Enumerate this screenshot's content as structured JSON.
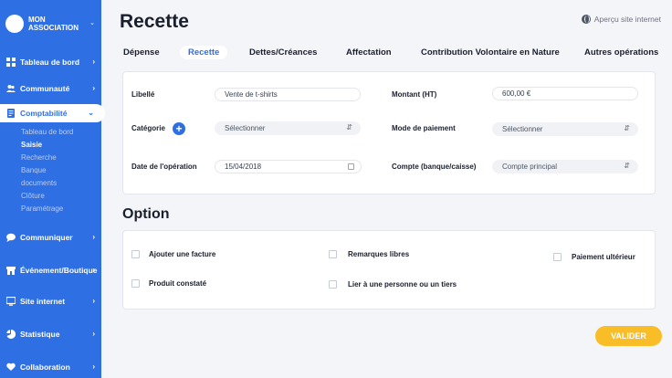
{
  "sidebar": {
    "brand": "MON\nASSOCIATION",
    "items": [
      {
        "label": "Tableau de bord",
        "icon": "dashboard-icon"
      },
      {
        "label": "Communauté",
        "icon": "users-icon"
      },
      {
        "label": "Comptabilité",
        "icon": "ledger-icon"
      },
      {
        "label": "Communiquer",
        "icon": "chat-icon"
      },
      {
        "label": "Événement/Boutique",
        "icon": "store-icon"
      },
      {
        "label": "Site internet",
        "icon": "monitor-icon"
      },
      {
        "label": "Statistique",
        "icon": "chart-icon"
      },
      {
        "label": "Collaboration",
        "icon": "collaboration-icon"
      }
    ],
    "subitems": [
      "Tableau de bord",
      "Saisie",
      "Recherche",
      "Banque",
      "documents",
      "Clôture",
      "Paramétrage"
    ]
  },
  "header": {
    "title": "Recette",
    "site_link": "Aperçu site internet"
  },
  "tabs": [
    "Dépense",
    "Recette",
    "Dettes/Créances",
    "Affectation",
    "Contribution Volontaire en Nature",
    "Autres opérations"
  ],
  "form": {
    "libelle_label": "Libellé",
    "libelle_value": "Vente de t-shirts",
    "montant_label": "Montant (HT)",
    "montant_value": "600,00 €",
    "categorie_label": "Catégorie",
    "categorie_value": "Sélectionner",
    "mode_label": "Mode de paiement",
    "mode_value": "Sélectionner",
    "date_label": "Date de l'opération",
    "date_value": "15/04/2018",
    "compte_label": "Compte (banque/caisse)",
    "compte_value": "Compte principal"
  },
  "option": {
    "title": "Option",
    "items": [
      "Ajouter une facture",
      "Remarques libres",
      "Paiement ultérieur",
      "Produit constaté",
      "Lier à une personne ou un tiers"
    ]
  },
  "actions": {
    "validate": "VALIDER"
  },
  "colors": {
    "primary": "#2f6fe4",
    "accent": "#f9bd28",
    "background": "#f4f5f8"
  }
}
